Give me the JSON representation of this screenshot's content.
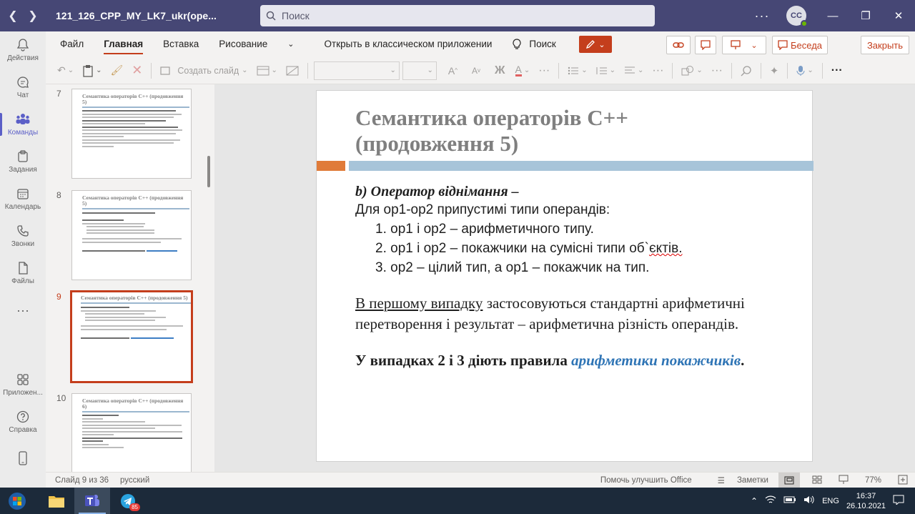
{
  "window": {
    "title": "121_126_CPP_MY_LK7_ukr(ope...",
    "search_placeholder": "Поиск",
    "more": "···",
    "avatar": "CC"
  },
  "rail": [
    {
      "label": "Действия",
      "icon": "bell-icon"
    },
    {
      "label": "Чат",
      "icon": "chat-icon"
    },
    {
      "label": "Команды",
      "icon": "teams-icon"
    },
    {
      "label": "Задания",
      "icon": "assignments-icon"
    },
    {
      "label": "Календарь",
      "icon": "calendar-icon"
    },
    {
      "label": "Звонки",
      "icon": "phone-icon"
    },
    {
      "label": "Файлы",
      "icon": "file-icon"
    },
    {
      "label": "···",
      "icon": "more-icon"
    },
    {
      "label": "Приложен...",
      "icon": "apps-icon"
    },
    {
      "label": "Справка",
      "icon": "help-icon"
    }
  ],
  "menu": {
    "items": [
      "Файл",
      "Главная",
      "Вставка",
      "Рисование"
    ],
    "open_desktop": "Открыть в классическом приложении",
    "search": "Поиск",
    "chat_btn": "Беседа",
    "close_btn": "Закрыть"
  },
  "toolbar": {
    "new_slide": "Создать слайд"
  },
  "thumbnails": [
    {
      "num": "7",
      "title": "Семантика операторів С++ (продовження 5)"
    },
    {
      "num": "8",
      "title": "Семантика операторів С++ (продовження 5)"
    },
    {
      "num": "9",
      "title": "Семантика операторів С++ (продовження 5)"
    },
    {
      "num": "10",
      "title": "Семантика операторів С++ (продовження 6)"
    }
  ],
  "slide": {
    "title_line1": "Семантика операторів С++",
    "title_line2": "(продовження 5)",
    "heading": "b) Оператор віднімання –",
    "intro": "Для op1-op2 припустимі типи операндів:",
    "items": [
      "1. op1 і op2 – арифметичного типу.",
      "2. op1 і op2 – покажчики на сумісні типи об`",
      "3. op2 – цілий тип, а op1 – покажчик на тип."
    ],
    "item2_tail": "єктів.",
    "para_underlined": "В першому випадку",
    "para_rest": " застосовуються стандартні арифметичні перетворення і результат – арифметична різність операндів.",
    "final_prefix": "У випадках 2 і 3 діють правила ",
    "final_link": "арифметики покажчиків",
    "final_suffix": "."
  },
  "status": {
    "slide_counter": "Слайд 9 из 36",
    "language": "русский",
    "feedback": "Помочь улучшить Office",
    "notes": "Заметки",
    "zoom": "77%"
  },
  "taskbar": {
    "lang": "ENG",
    "time": "16:37",
    "date": "26.10.2021",
    "telegram_badge": "85"
  },
  "colors": {
    "teams_bar": "#464775",
    "office_accent": "#c43e1c",
    "slide_title": "#7f7f7f",
    "link": "#2e74b5"
  }
}
